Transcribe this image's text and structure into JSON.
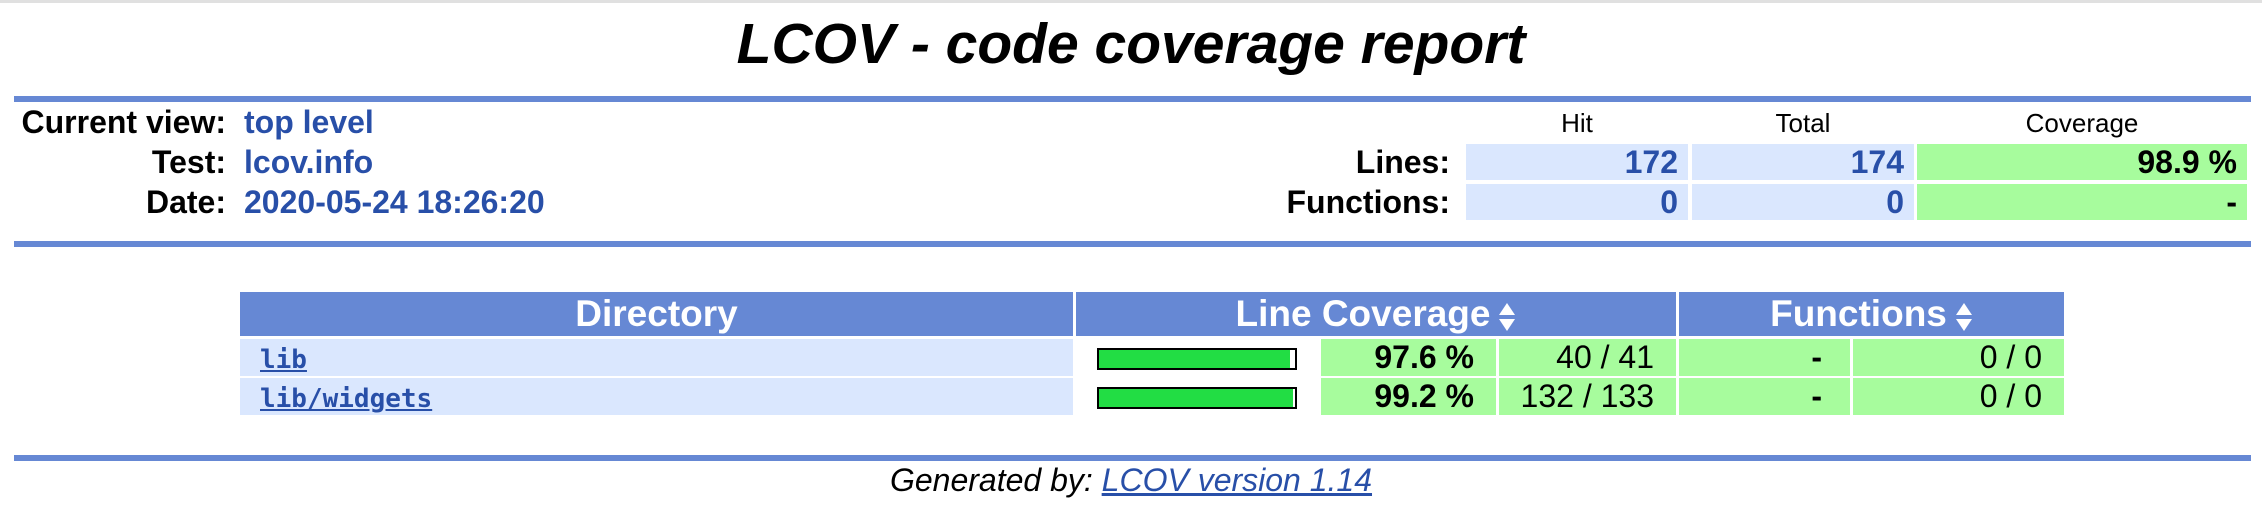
{
  "title": "LCOV - code coverage report",
  "header": {
    "current_view_label": "Current view:",
    "current_view_value": "top level",
    "test_label": "Test:",
    "test_value": "lcov.info",
    "date_label": "Date:",
    "date_value": "2020-05-24 18:26:20"
  },
  "summary": {
    "col_hit": "Hit",
    "col_total": "Total",
    "col_coverage": "Coverage",
    "lines": {
      "label": "Lines:",
      "hit": "172",
      "total": "174",
      "coverage": "98.9 %"
    },
    "functions": {
      "label": "Functions:",
      "hit": "0",
      "total": "0",
      "coverage": "-"
    }
  },
  "table": {
    "headers": {
      "directory": "Directory",
      "line_coverage": "Line Coverage",
      "functions": "Functions"
    },
    "rows": [
      {
        "name": "lib",
        "line_pct": "97.6 %",
        "line_fraction": 0.976,
        "line_count": "40 / 41",
        "func_pct": "-",
        "func_count": "0 / 0"
      },
      {
        "name": "lib/widgets",
        "line_pct": "99.2 %",
        "line_fraction": 0.992,
        "line_count": "132 / 133",
        "func_pct": "-",
        "func_count": "0 / 0"
      }
    ]
  },
  "footer": {
    "generated_by": "Generated by:",
    "link_text": "LCOV version 1.14"
  },
  "colors": {
    "rule_blue": "#6688d4",
    "link_blue": "#284fa8",
    "pale_blue": "#dae7fe",
    "coverage_green": "#a7fc9d",
    "bar_green": "#22dd44"
  }
}
